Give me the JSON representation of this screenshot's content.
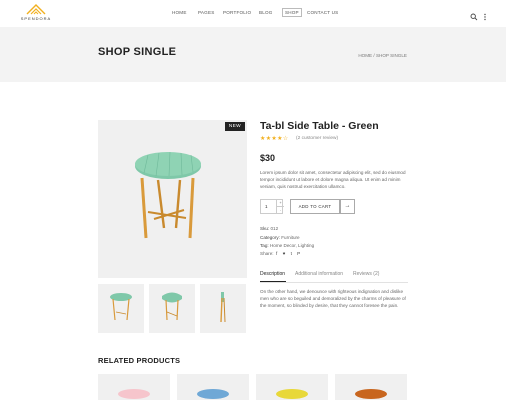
{
  "brand": {
    "name": "SPENDORA"
  },
  "nav": {
    "items": [
      "HOME",
      "PAGES",
      "PORTFOLIO",
      "BLOG",
      "SHOP",
      "CONTACT US"
    ],
    "active": "SHOP"
  },
  "header_icons": [
    "search-icon",
    "more-vertical-icon"
  ],
  "banner": {
    "title": "SHOP SINGLE",
    "breadcrumb": "HOME  /  SHOP SINGLE"
  },
  "gallery": {
    "badge": "NEW",
    "thumbs": [
      "side-table-top",
      "side-table-side",
      "side-table-folded"
    ]
  },
  "product": {
    "title": "Ta-bl Side Table - Green",
    "rating": 4,
    "rating_max": 5,
    "review_link": "(2 customer review)",
    "price": "$30",
    "description": "Lorem ipsum dolor sit amet, consectetur adipiscing elit, sed do eiusmod tempor incididunt ut labore et dolore magna aliqua. Ut enim ad minim veniam, quis nostrud exercitation ullamco.",
    "quantity": "1",
    "qty_up": "+",
    "qty_down": "-",
    "add_to_cart": "ADD TO CART",
    "arrow": "→",
    "sku_label": "Sku:",
    "sku": "012",
    "category_label": "Category:",
    "category": "Furniture",
    "tag_label": "Tag:",
    "tags": "Home Decor, Lighting",
    "share_label": "Share:",
    "share_icons": [
      "f",
      "♥",
      "t",
      "P"
    ]
  },
  "tabs": {
    "items": [
      "Description",
      "Additional information",
      "Reviews (2)"
    ],
    "active": "Description",
    "content": "On the other hand, we denounce with righteous indignation and dislike men who are so beguiled and demoralized by the charms of pleasure of the moment, so blinded by desire, that they cannot foresee the pain."
  },
  "related": {
    "title": "RELATED PRODUCTS",
    "items": [
      "pink-table",
      "blue-table",
      "yellow-table",
      "wood-table"
    ]
  },
  "colors": {
    "table_green": "#7fc8a9",
    "table_legs": "#d99a3b",
    "star": "#f2b01e",
    "pink": "#f6c5cc",
    "blue": "#6fa8d6",
    "yellow": "#e8d83a",
    "wood": "#c8661f"
  }
}
